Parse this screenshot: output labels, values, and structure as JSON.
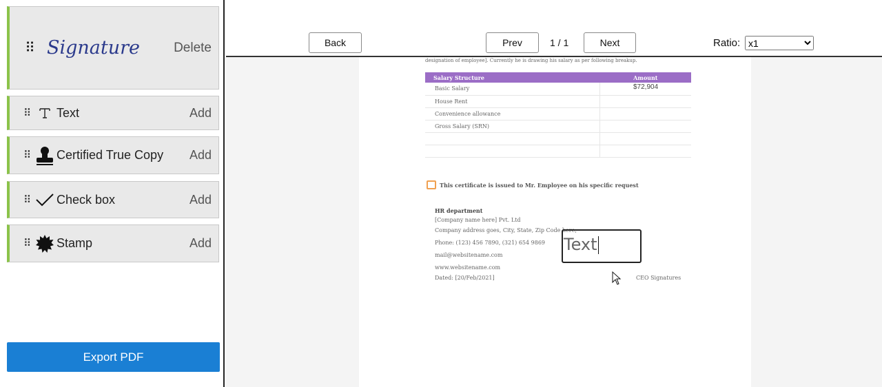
{
  "sidebar": {
    "signature": {
      "text": "Signature",
      "action": "Delete"
    },
    "items": [
      {
        "label": "Text",
        "action": "Add",
        "icon": "text-cursor-icon"
      },
      {
        "label": "Certified True Copy",
        "action": "Add",
        "icon": "stamp-icon"
      },
      {
        "label": "Check box",
        "action": "Add",
        "icon": "check-icon"
      },
      {
        "label": "Stamp",
        "action": "Add",
        "icon": "seal-icon"
      }
    ],
    "export_label": "Export PDF",
    "accent": "#8bc34a",
    "export_color": "#1a7fd4"
  },
  "toolbar": {
    "back": "Back",
    "prev": "Prev",
    "page": "1 / 1",
    "next": "Next",
    "ratio_label": "Ratio:",
    "ratio_value": "x1"
  },
  "document": {
    "intro": "designation of employee]. Currently he is drawing his salary as per following breakup.",
    "table": {
      "headers": [
        "Salary  Structure",
        "Amount"
      ],
      "rows": [
        {
          "label": "Basic Salary",
          "amount": "$72,904"
        },
        {
          "label": "House Rent",
          "amount": ""
        },
        {
          "label": "Convenience allowance",
          "amount": ""
        },
        {
          "label": "Gross Salary  (SRN)",
          "amount": ""
        },
        {
          "label": "",
          "amount": ""
        },
        {
          "label": "",
          "amount": ""
        }
      ],
      "header_color": "#9b6dc6"
    },
    "notice": "This certificate is issued to Mr. Employee on his specific request",
    "hr_title": "HR department",
    "hr_lines": [
      "[Company name here] Pvt. Ltd",
      "Company address goes, City, State, Zip Code  here,",
      "Phone: (123) 456 7890,  (321) 654 9869",
      "mail@websitename.com",
      "www.websitename.com",
      "Dated: [20/Feb/2021]"
    ],
    "ceo": "CEO Signatures",
    "textbox_value": "Text"
  }
}
